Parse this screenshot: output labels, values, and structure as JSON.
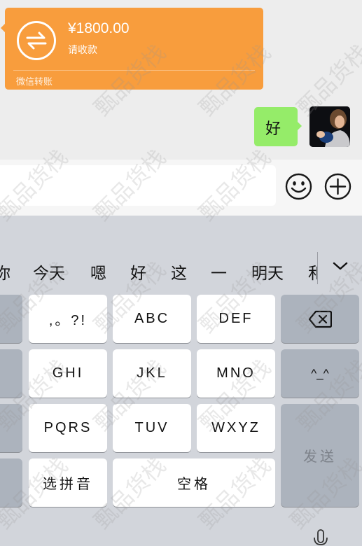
{
  "chat": {
    "transfer": {
      "amount": "¥1800.00",
      "status": "请收款",
      "source": "微信转账",
      "icon": "transfer-arrows-icon",
      "color": "#f89d3d"
    },
    "reply": {
      "text": "好",
      "color": "#95ec69"
    },
    "avatar": "avatar"
  },
  "input_bar": {
    "text_value": "",
    "emoji_icon": "emoji-icon",
    "plus_icon": "plus-icon"
  },
  "keyboard": {
    "candidates": [
      "你",
      "今天",
      "嗯",
      "好",
      "这",
      "一",
      "明天",
      "和"
    ],
    "expand_icon": "chevron-down-icon",
    "keys": {
      "punct": ",。?!",
      "abc": "ABC",
      "def": "DEF",
      "ghi": "GHI",
      "jkl": "JKL",
      "mno": "MNO",
      "pqrs": "PQRS",
      "tuv": "TUV",
      "wxyz": "WXYZ",
      "select_pinyin": "选拼音",
      "space": "空格",
      "send": "发送",
      "delete_icon": "backspace-icon",
      "emoticon": "^_^"
    },
    "mic_icon": "microphone-icon"
  },
  "watermark": "甄品货栈"
}
